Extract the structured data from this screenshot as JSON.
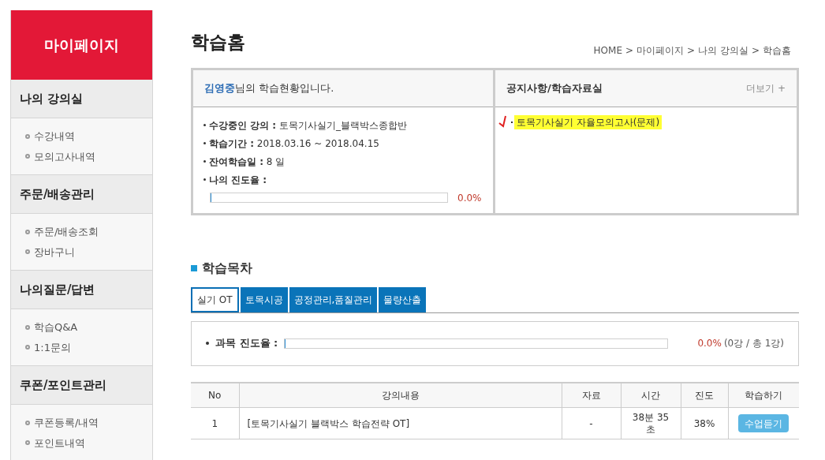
{
  "sidebar": {
    "title": "마이페이지",
    "sections": [
      {
        "heading": "나의 강의실",
        "items": [
          "수강내역",
          "모의고사내역"
        ]
      },
      {
        "heading": "주문/배송관리",
        "items": [
          "주문/배송조회",
          "장바구니"
        ]
      },
      {
        "heading": "나의질문/답변",
        "items": [
          "학습Q&A",
          "1:1문의"
        ]
      },
      {
        "heading": "쿠폰/포인트관리",
        "items": [
          "쿠폰등록/내역",
          "포인트내역"
        ]
      }
    ]
  },
  "page_title": "학습홈",
  "breadcrumb": {
    "separator": ">",
    "items": [
      "HOME",
      "마이페이지",
      "나의 강의실",
      "학습홈"
    ]
  },
  "status": {
    "user_name": "김영중",
    "greeting": "님의 학습현황입니다.",
    "fields": [
      {
        "label": "수강중인 강의 :",
        "value": "토목기사실기_블랙박스종합반"
      },
      {
        "label": "학습기간 :",
        "value": "2018.03.16 ~ 2018.04.15"
      },
      {
        "label": "잔여학습일 :",
        "value": "8 일"
      },
      {
        "label": "나의 진도율 :"
      }
    ],
    "progress": {
      "level": 0,
      "reading": "0.0%"
    }
  },
  "notices": {
    "title": "공지사항/학습자료실",
    "more": "더보기 +",
    "items": [
      {
        "text": "토목기사실기 자율모의고사(문제)",
        "highlighted": true
      }
    ]
  },
  "toc": {
    "title": "학습목차",
    "tabs": [
      {
        "label": "실기 OT",
        "selected": true
      },
      {
        "label": "토목시공",
        "selected": false
      },
      {
        "label": "공정관리,품질관리",
        "selected": false
      },
      {
        "label": "물량산출",
        "selected": false
      }
    ],
    "progress_label": "과목 진도율 :",
    "progress": {
      "level": 0,
      "reading": "0.0%",
      "detail": "(0강 / 총 1강)"
    }
  },
  "table": {
    "columns": [
      "No",
      "강의내용",
      "자료",
      "시간",
      "진도",
      "학습하기"
    ],
    "rows": [
      {
        "no": "1",
        "title": "[토목기사실기 블랙박스 학습전략 OT]",
        "material": "-",
        "time": "38분 35 초",
        "progress": "38%",
        "action": "수업듣기"
      }
    ]
  }
}
